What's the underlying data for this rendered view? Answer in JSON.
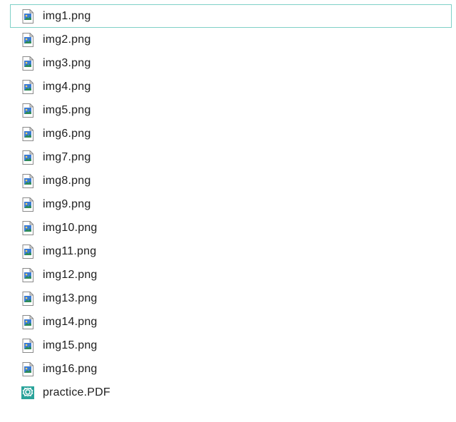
{
  "files": [
    {
      "name": "img1.png",
      "type": "image",
      "selected": true
    },
    {
      "name": "img2.png",
      "type": "image",
      "selected": false
    },
    {
      "name": "img3.png",
      "type": "image",
      "selected": false
    },
    {
      "name": "img4.png",
      "type": "image",
      "selected": false
    },
    {
      "name": "img5.png",
      "type": "image",
      "selected": false
    },
    {
      "name": "img6.png",
      "type": "image",
      "selected": false
    },
    {
      "name": "img7.png",
      "type": "image",
      "selected": false
    },
    {
      "name": "img8.png",
      "type": "image",
      "selected": false
    },
    {
      "name": "img9.png",
      "type": "image",
      "selected": false
    },
    {
      "name": "img10.png",
      "type": "image",
      "selected": false
    },
    {
      "name": "img11.png",
      "type": "image",
      "selected": false
    },
    {
      "name": "img12.png",
      "type": "image",
      "selected": false
    },
    {
      "name": "img13.png",
      "type": "image",
      "selected": false
    },
    {
      "name": "img14.png",
      "type": "image",
      "selected": false
    },
    {
      "name": "img15.png",
      "type": "image",
      "selected": false
    },
    {
      "name": "img16.png",
      "type": "image",
      "selected": false
    },
    {
      "name": "practice.PDF",
      "type": "pdf",
      "selected": false
    }
  ]
}
